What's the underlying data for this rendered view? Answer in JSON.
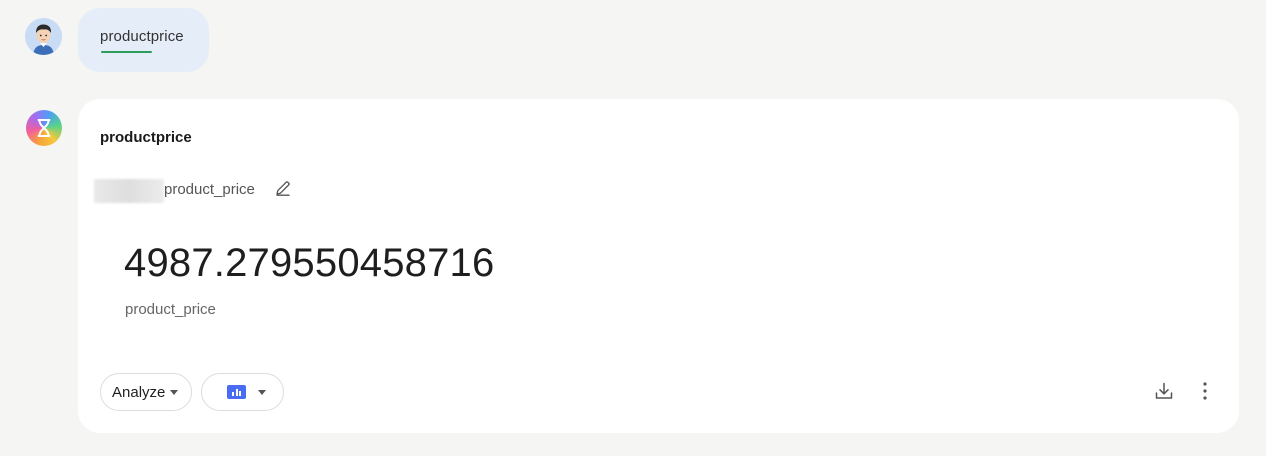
{
  "user_message": {
    "text": "productprice"
  },
  "response": {
    "title": "productprice",
    "field_name": "product_price",
    "value": "4987.279550458716",
    "value_label": "product_price",
    "analyze_button": "Analyze",
    "icons": {
      "edit": "pencil-icon",
      "chart": "bar-chart-icon",
      "download": "download-icon",
      "more": "more-vertical-icon"
    }
  },
  "colors": {
    "background": "#f5f5f4",
    "user_bubble": "#e5edf8",
    "underline": "#2e9d5b",
    "chart_icon": "#4a6cf2"
  }
}
